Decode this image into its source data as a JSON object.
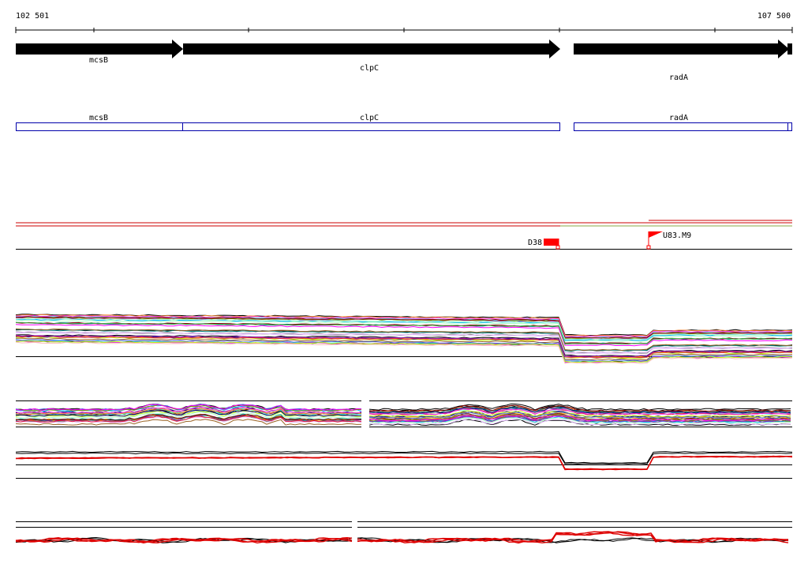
{
  "ruler": {
    "start_label": "102 501",
    "end_label": "107 500"
  },
  "genes": [
    {
      "name": "mcsB",
      "label": "mcsB"
    },
    {
      "name": "clpC",
      "label": "clpC"
    },
    {
      "name": "radA",
      "label": "radA"
    }
  ],
  "regions": [
    {
      "label": "mcsB"
    },
    {
      "label": "clpC"
    },
    {
      "label": "radA"
    }
  ],
  "markers": [
    {
      "label": "D38",
      "color": "#ff0000"
    },
    {
      "label": "U83.M9",
      "color": "#ff0000"
    }
  ],
  "colors": {
    "gene_arrow": "#000000",
    "region_box": "#0000aa",
    "highlight": "#cc0000",
    "track_palette": [
      "#e6194b",
      "#3cb44b",
      "#4363d8",
      "#f58231",
      "#911eb4",
      "#46f0f0",
      "#f032e6",
      "#bcf60c",
      "#fabebe",
      "#008080",
      "#e6beff",
      "#9a6324",
      "#800000",
      "#aaffc3",
      "#808000",
      "#000075",
      "#808080",
      "#ff00ff",
      "#00aaff",
      "#ffaa00"
    ]
  }
}
